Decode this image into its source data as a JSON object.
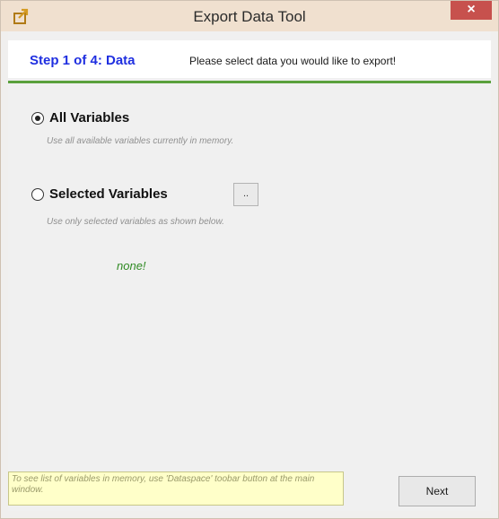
{
  "window": {
    "title": "Export Data Tool",
    "close_glyph": "×",
    "icon": "export-icon"
  },
  "header": {
    "step": "Step 1 of 4: Data",
    "description": "Please select data you would like to export!"
  },
  "options": {
    "all_variables": {
      "label": "All Variables",
      "hint": "Use all available variables currently in memory.",
      "selected": true
    },
    "selected_variables": {
      "label": "Selected Variables",
      "hint": "Use only selected variables as shown below.",
      "selected": false,
      "browse_label": "..",
      "selection_text": "none!"
    }
  },
  "footer": {
    "tip": "To see list of variables in memory, use 'Dataspace' toobar button at the main window.",
    "next_label": "Next"
  },
  "colors": {
    "accent_step": "#1f2fe0",
    "divider": "#5aa03c",
    "none_text": "#2f8a23",
    "close": "#c7514d"
  }
}
